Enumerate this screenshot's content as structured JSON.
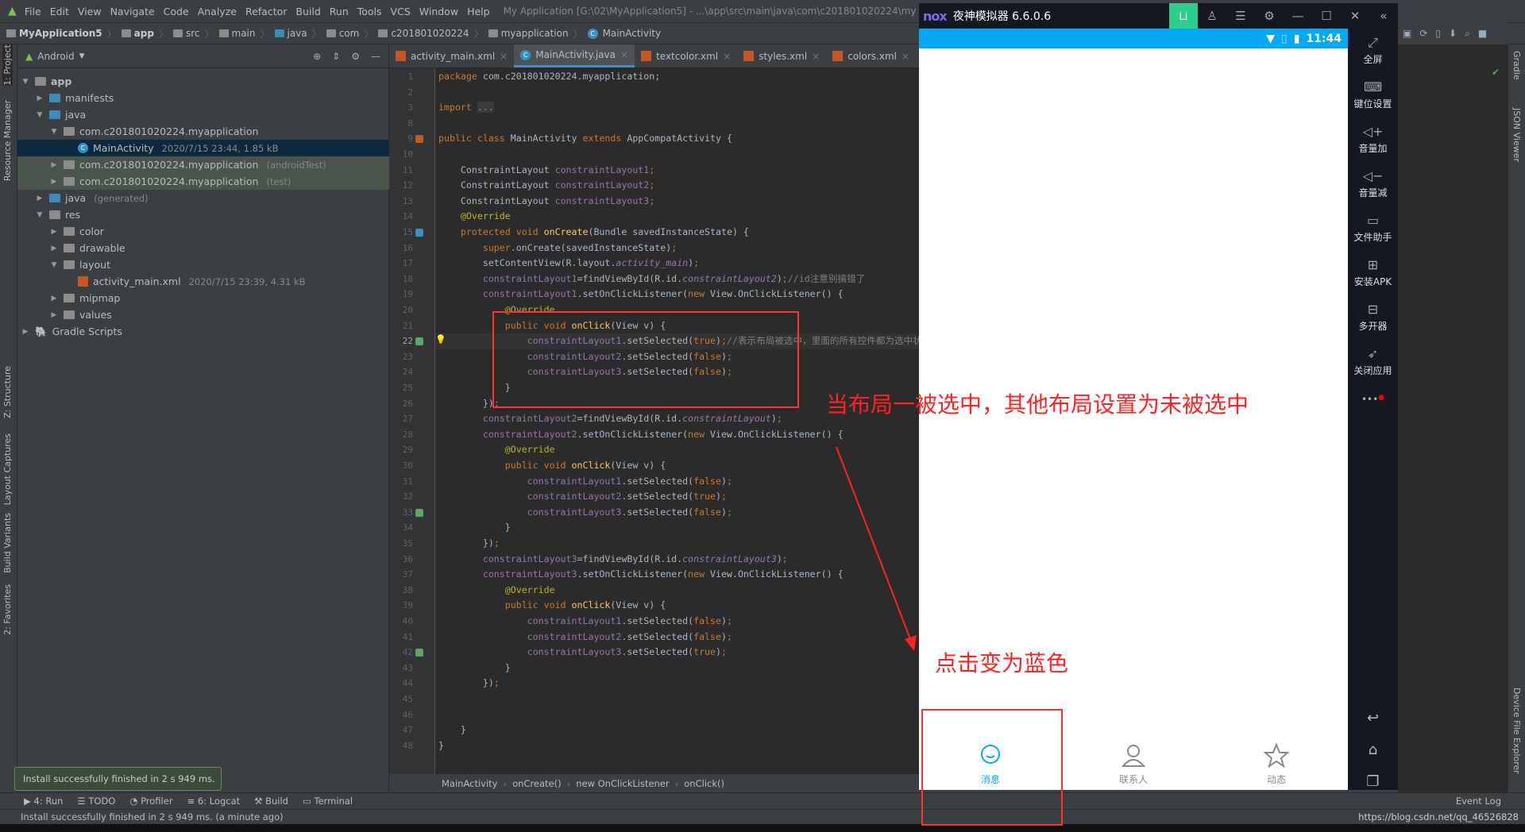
{
  "menu": {
    "items": [
      "File",
      "Edit",
      "View",
      "Navigate",
      "Code",
      "Analyze",
      "Refactor",
      "Build",
      "Run",
      "Tools",
      "VCS",
      "Window",
      "Help"
    ],
    "title": "My Application [G:\\02\\MyApplication5] - ...\\app\\src\\main\\java\\com\\c201801020224\\my"
  },
  "breadcrumb": [
    "MyApplication5",
    "app",
    "src",
    "main",
    "java",
    "com",
    "c201801020224",
    "myapplication",
    "MainActivity"
  ],
  "left_tools": [
    "1: Project",
    "Resource Manager",
    "Z: Structure",
    "Layout Captures",
    "Build Variants",
    "2: Favorites"
  ],
  "right_tools": [
    "Gradle",
    "JSON Viewer",
    "Device File Explorer"
  ],
  "project": {
    "view": "Android",
    "tree": [
      {
        "label": "app",
        "depth": 0,
        "arrow": "open",
        "icon": "folder",
        "bold": true
      },
      {
        "label": "manifests",
        "depth": 1,
        "arrow": "closed",
        "icon": "folder-blue"
      },
      {
        "label": "java",
        "depth": 1,
        "arrow": "open",
        "icon": "folder-blue"
      },
      {
        "label": "com.c201801020224.myapplication",
        "depth": 2,
        "arrow": "open",
        "icon": "package"
      },
      {
        "label": "MainActivity",
        "depth": 3,
        "arrow": "none",
        "icon": "class",
        "meta": "2020/7/15 23:44, 1.85 kB",
        "selected": true
      },
      {
        "label": "com.c201801020224.myapplication",
        "depth": 2,
        "arrow": "closed",
        "icon": "package",
        "meta": "(androidTest)",
        "test": true
      },
      {
        "label": "com.c201801020224.myapplication",
        "depth": 2,
        "arrow": "closed",
        "icon": "package",
        "meta": "(test)",
        "test": true
      },
      {
        "label": "java",
        "depth": 1,
        "arrow": "closed",
        "icon": "folder-blue",
        "meta": "(generated)"
      },
      {
        "label": "res",
        "depth": 1,
        "arrow": "open",
        "icon": "folder"
      },
      {
        "label": "color",
        "depth": 2,
        "arrow": "closed",
        "icon": "package"
      },
      {
        "label": "drawable",
        "depth": 2,
        "arrow": "closed",
        "icon": "package"
      },
      {
        "label": "layout",
        "depth": 2,
        "arrow": "open",
        "icon": "package"
      },
      {
        "label": "activity_main.xml",
        "depth": 3,
        "arrow": "none",
        "icon": "xml",
        "meta": "2020/7/15 23:39, 4.31 kB"
      },
      {
        "label": "mipmap",
        "depth": 2,
        "arrow": "closed",
        "icon": "package"
      },
      {
        "label": "values",
        "depth": 2,
        "arrow": "closed",
        "icon": "package"
      },
      {
        "label": "Gradle Scripts",
        "depth": 0,
        "arrow": "closed",
        "icon": "gradle"
      }
    ]
  },
  "tabs": [
    {
      "label": "activity_main.xml",
      "icon": "xml"
    },
    {
      "label": "MainActivity.java",
      "icon": "class",
      "active": true
    },
    {
      "label": "textcolor.xml",
      "icon": "xml"
    },
    {
      "label": "styles.xml",
      "icon": "xml"
    },
    {
      "label": "colors.xml",
      "icon": "xml"
    }
  ],
  "code": {
    "current_line": 22,
    "lines": [
      [
        1,
        [
          [
            "kw",
            "package "
          ],
          [
            "",
            "com.c201801020224.myapplication;"
          ]
        ]
      ],
      [
        2,
        []
      ],
      [
        3,
        [
          [
            "kw",
            "import "
          ],
          [
            "fold3",
            "..."
          ]
        ]
      ],
      [
        8,
        []
      ],
      [
        9,
        [
          [
            "kw",
            "public class "
          ],
          [
            "",
            "MainActivity "
          ],
          [
            "kw",
            "extends "
          ],
          [
            "",
            "AppCompatActivity {"
          ]
        ]
      ],
      [
        10,
        []
      ],
      [
        11,
        [
          [
            "",
            "    ConstraintLayout "
          ],
          [
            "fld",
            "constraintLayout1"
          ],
          [
            "kw",
            ";"
          ]
        ]
      ],
      [
        12,
        [
          [
            "",
            "    ConstraintLayout "
          ],
          [
            "fld",
            "constraintLayout2"
          ],
          [
            "kw",
            ";"
          ]
        ]
      ],
      [
        13,
        [
          [
            "",
            "    ConstraintLayout "
          ],
          [
            "fld",
            "constraintLayout3"
          ],
          [
            "kw",
            ";"
          ]
        ]
      ],
      [
        14,
        [
          [
            "ann",
            "    @Override"
          ]
        ]
      ],
      [
        15,
        [
          [
            "kw",
            "    protected void "
          ],
          [
            "fn",
            "onCreate"
          ],
          [
            "",
            "(Bundle savedInstanceState) {"
          ]
        ]
      ],
      [
        16,
        [
          [
            "kw",
            "        super"
          ],
          [
            "",
            ".onCreate(savedInstanceState)"
          ],
          [
            "kw",
            ";"
          ]
        ]
      ],
      [
        17,
        [
          [
            "",
            "        setContentView(R.layout."
          ],
          [
            "it",
            "activity_main"
          ],
          [
            "",
            ")"
          ],
          [
            "kw",
            ";"
          ]
        ]
      ],
      [
        18,
        [
          [
            "fld",
            "        constraintLayout1"
          ],
          [
            "",
            "=findViewById(R.id."
          ],
          [
            "it",
            "constraintLayout2"
          ],
          [
            "",
            ")"
          ],
          [
            "kw",
            ";"
          ],
          [
            "cm",
            "//id注意别搞错了"
          ]
        ]
      ],
      [
        19,
        [
          [
            "fld",
            "        constraintLayout1"
          ],
          [
            "",
            ".setOnClickListener("
          ],
          [
            "kw",
            "new "
          ],
          [
            "",
            "View.OnClickListener() {"
          ]
        ]
      ],
      [
        20,
        [
          [
            "ann",
            "            @Override"
          ]
        ]
      ],
      [
        21,
        [
          [
            "kw",
            "            public void "
          ],
          [
            "fn",
            "onClick"
          ],
          [
            "",
            "(View v) {"
          ]
        ]
      ],
      [
        22,
        [
          [
            "fld",
            "                constraintLayout1"
          ],
          [
            "",
            ".setSelected("
          ],
          [
            "kw",
            "true"
          ],
          [
            "",
            ")"
          ],
          [
            "kw",
            ";"
          ],
          [
            "cm",
            "//表示布局被选中，里面的所有控件都为选中状态"
          ]
        ]
      ],
      [
        23,
        [
          [
            "fld",
            "                constraintLayout2"
          ],
          [
            "",
            ".setSelected("
          ],
          [
            "kw",
            "false"
          ],
          [
            "",
            ")"
          ],
          [
            "kw",
            ";"
          ]
        ]
      ],
      [
        24,
        [
          [
            "fld",
            "                constraintLayout3"
          ],
          [
            "",
            ".setSelected("
          ],
          [
            "kw",
            "false"
          ],
          [
            "",
            ")"
          ],
          [
            "kw",
            ";"
          ]
        ]
      ],
      [
        25,
        [
          [
            "",
            "            }"
          ]
        ]
      ],
      [
        26,
        [
          [
            "",
            "        })"
          ],
          [
            "kw",
            ";"
          ]
        ]
      ],
      [
        27,
        [
          [
            "fld",
            "        constraintLayout2"
          ],
          [
            "",
            "=findViewById(R.id."
          ],
          [
            "it",
            "constraintLayout"
          ],
          [
            "",
            ")"
          ],
          [
            "kw",
            ";"
          ]
        ]
      ],
      [
        28,
        [
          [
            "fld",
            "        constraintLayout2"
          ],
          [
            "",
            ".setOnClickListener("
          ],
          [
            "kw",
            "new "
          ],
          [
            "",
            "View.OnClickListener() {"
          ]
        ]
      ],
      [
        29,
        [
          [
            "ann",
            "            @Override"
          ]
        ]
      ],
      [
        30,
        [
          [
            "kw",
            "            public void "
          ],
          [
            "fn",
            "onClick"
          ],
          [
            "",
            "(View v) {"
          ]
        ]
      ],
      [
        31,
        [
          [
            "fld",
            "                constraintLayout1"
          ],
          [
            "",
            ".setSelected("
          ],
          [
            "kw",
            "false"
          ],
          [
            "",
            ")"
          ],
          [
            "kw",
            ";"
          ]
        ]
      ],
      [
        32,
        [
          [
            "fld",
            "                constraintLayout2"
          ],
          [
            "",
            ".setSelected("
          ],
          [
            "kw",
            "true"
          ],
          [
            "",
            ")"
          ],
          [
            "kw",
            ";"
          ]
        ]
      ],
      [
        33,
        [
          [
            "fld",
            "                constraintLayout3"
          ],
          [
            "",
            ".setSelected("
          ],
          [
            "kw",
            "false"
          ],
          [
            "",
            ")"
          ],
          [
            "kw",
            ";"
          ]
        ]
      ],
      [
        34,
        [
          [
            "",
            "            }"
          ]
        ]
      ],
      [
        35,
        [
          [
            "",
            "        })"
          ],
          [
            "kw",
            ";"
          ]
        ]
      ],
      [
        36,
        [
          [
            "fld",
            "        constraintLayout3"
          ],
          [
            "",
            "=findViewById(R.id."
          ],
          [
            "it",
            "constraintLayout3"
          ],
          [
            "",
            ")"
          ],
          [
            "kw",
            ";"
          ]
        ]
      ],
      [
        37,
        [
          [
            "fld",
            "        constraintLayout3"
          ],
          [
            "",
            ".setOnClickListener("
          ],
          [
            "kw",
            "new "
          ],
          [
            "",
            "View.OnClickListener() {"
          ]
        ]
      ],
      [
        38,
        [
          [
            "ann",
            "            @Override"
          ]
        ]
      ],
      [
        39,
        [
          [
            "kw",
            "            public void "
          ],
          [
            "fn",
            "onClick"
          ],
          [
            "",
            "(View v) {"
          ]
        ]
      ],
      [
        40,
        [
          [
            "fld",
            "                constraintLayout1"
          ],
          [
            "",
            ".setSelected("
          ],
          [
            "kw",
            "false"
          ],
          [
            "",
            ")"
          ],
          [
            "kw",
            ";"
          ]
        ]
      ],
      [
        41,
        [
          [
            "fld",
            "                constraintLayout2"
          ],
          [
            "",
            ".setSelected("
          ],
          [
            "kw",
            "false"
          ],
          [
            "",
            ")"
          ],
          [
            "kw",
            ";"
          ]
        ]
      ],
      [
        42,
        [
          [
            "fld",
            "                constraintLayout3"
          ],
          [
            "",
            ".setSelected("
          ],
          [
            "kw",
            "true"
          ],
          [
            "",
            ")"
          ],
          [
            "kw",
            ";"
          ]
        ]
      ],
      [
        43,
        [
          [
            "",
            "            }"
          ]
        ]
      ],
      [
        44,
        [
          [
            "",
            "        })"
          ],
          [
            "kw",
            ";"
          ]
        ]
      ],
      [
        45,
        []
      ],
      [
        46,
        []
      ],
      [
        47,
        [
          [
            "",
            "    }"
          ]
        ]
      ],
      [
        48,
        [
          [
            "",
            "}"
          ]
        ]
      ]
    ]
  },
  "editor_breadcrumb": [
    "MainActivity",
    "onCreate()",
    "new OnClickListener",
    "onClick()"
  ],
  "tool_buttons": [
    "4: Run",
    "TODO",
    "Profiler",
    "6: Logcat",
    "Build",
    "Terminal"
  ],
  "event_log": "Event Log",
  "status": {
    "message": "Install successfully finished in 2 s 949 ms. (a minute ago)",
    "right": "https://blog.csdn.net/qq_46526828"
  },
  "toast": "Install successfully finished in 2 s 949 ms.",
  "emulator": {
    "brand": "nox",
    "title": "夜神模拟器 6.6.0.6",
    "time": "11:44",
    "accent": "#03a9f4",
    "side": [
      "全屏",
      "键位设置",
      "音量加",
      "音量减",
      "文件助手",
      "安装APK",
      "多开器",
      "关闭应用"
    ],
    "nav": [
      {
        "label": "消息",
        "icon": "chat-icon",
        "active": true
      },
      {
        "label": "联系人",
        "icon": "person-icon"
      },
      {
        "label": "动态",
        "icon": "star-icon"
      }
    ]
  },
  "annotations": {
    "note1": "当布局一被选中，其他布局设置为未被选中",
    "note2": "点击变为蓝色",
    "color": "#ff2222"
  }
}
